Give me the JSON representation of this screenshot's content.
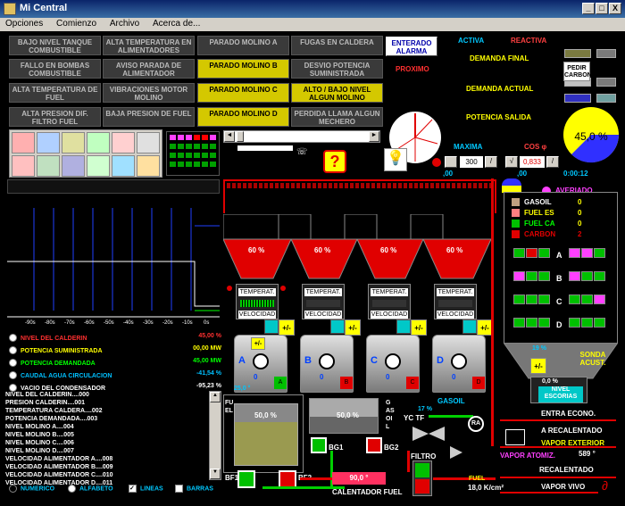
{
  "window": {
    "title": "Mi Central",
    "controls": [
      "_",
      "□",
      "X"
    ]
  },
  "menu": [
    "Opciones",
    "Comienzo",
    "Archivo",
    "Acerca de..."
  ],
  "alarms": {
    "col1": [
      "BAJO NIVEL TANQUE COMBUSTIBLE",
      "FALLO EN BOMBAS COMBUSTIBLE",
      "ALTA TEMPERATURA DE FUEL",
      "ALTA PRESION DIF. FILTRO FUEL"
    ],
    "col2": [
      "ALTA TEMPERATURA EN ALIMENTADORES",
      "AVISO PARADA DE ALIMENTADOR",
      "VIBRACIONES MOTOR MOLINO",
      "BAJA PRESION DE FUEL"
    ],
    "col3": [
      "PARADO MOLINO A",
      "PARADO MOLINO B",
      "PARADO MOLINO C",
      "PARADO MOLINO D"
    ],
    "col4": [
      "FUGAS EN CALDERA",
      "DESVIO POTENCIA SUMINISTRADA",
      "ALTO / BAJO NIVEL ALGUN MOLINO",
      "PERDIDA LLAMA ALGUN MECHERO"
    ]
  },
  "alarm_ack": {
    "label": "ENTERADO ALARMA",
    "next": "PROXIMO"
  },
  "power": {
    "activa": "ACTIVA",
    "reactiva": "REACTIVA",
    "demanda_final": "DEMANDA FINAL",
    "demanda_actual": "DEMANDA ACTUAL",
    "potencia_salida": "POTENCIA SALIDA",
    "pedir_carbon": "PEDIR CARBON",
    "maxima": "MAXIMA",
    "cos": "COS φ",
    "maxima_value": "300",
    "cos_value": "0,833",
    "zero_left": ",00",
    "zero_right": ",00",
    "time": "0:00:12",
    "pie_value": "45,0 %",
    "colors": {
      "activa": "#00c8ff",
      "reactiva": "#ff4040"
    }
  },
  "hoppers": [
    "60 %",
    "60 %",
    "60 %",
    "60 %"
  ],
  "mills": [
    {
      "id": "A",
      "value": "0",
      "btn": "A"
    },
    {
      "id": "B",
      "value": "0",
      "btn": "B"
    },
    {
      "id": "C",
      "value": "0",
      "btn": "C"
    },
    {
      "id": "D",
      "value": "0",
      "btn": "D"
    }
  ],
  "mill_labels": {
    "temp": "TEMPERAT.",
    "vel": "VELOCIDAD",
    "pm": "+/-"
  },
  "mill_a_temp": "25,0 °",
  "chart_axis": [
    "-90s",
    "-80s",
    "-70s",
    "-60s",
    "-50s",
    "-40s",
    "-30s",
    "-20s",
    "-10s",
    "0s"
  ],
  "params": [
    {
      "label": "NIVEL DEL CALDERIN",
      "value": "45,00 %",
      "color": "#ff3030"
    },
    {
      "label": "POTENCIA SUMINISTRADA",
      "value": "00,00 MW",
      "color": "#ffff00"
    },
    {
      "label": "POTENCIA DEMANDADA",
      "value": "45,00 MW",
      "color": "#00ff00"
    },
    {
      "label": "CAUDAL AGUA CIRCULACION",
      "value": "-41,54 %",
      "color": "#00c0ff"
    },
    {
      "label": "VACIO DEL CONDENSADOR",
      "value": "-95,23 %",
      "color": "#ffffff"
    }
  ],
  "codes": [
    "NIVEL DEL CALDERIN....000",
    "PRESION CALDERIN....001",
    "TEMPERATURA CALDERA....002",
    "POTENCIA DEMANDADA....003",
    "NIVEL MOLINO A....004",
    "NIVEL MOLINO B....005",
    "NIVEL MOLINO C....006",
    "NIVEL MOLINO D....007",
    "VELOCIDAD ALIMENTADOR A....008",
    "VELOCIDAD ALIMENTADOR B....009",
    "VELOCIDAD ALIMENTADOR C....010",
    "VELOCIDAD ALIMENTADOR D....011"
  ],
  "footer": {
    "numerico": "NUMERICO",
    "alfabeto": "ALFABETO",
    "lineas": "LINEAS",
    "barras": "BARRAS"
  },
  "fuel": {
    "fuel_label": "FUEL",
    "gasoil_label": "GASOIL",
    "tank_fuel": "50,0 %",
    "tank_gasoil": "50,0 %",
    "bf1": "BF1",
    "bf2": "BF2",
    "bg1": "BG1",
    "bg2": "BG2",
    "gasoil_tag": "GASOIL",
    "yc_tf": "YC TF",
    "pct17": "17 %",
    "ra": "RA",
    "filtro": "FILTRO",
    "calentador_val": "90,0 °",
    "calentador": "CALENTADOR FUEL",
    "fuel_out": "FUEL",
    "fuel_out_val": "18,0 K/cm²"
  },
  "right": {
    "averiado": "AVERIADO",
    "gasoil": "GASOIL",
    "fuel_es": "FUEL ES",
    "fuel_ca": "FUEL CA",
    "carbon": "CARBON",
    "v_gasoil": "0",
    "v_fuel_es": "0",
    "v_fuel_ca": "0",
    "v_carbon": "2",
    "rows": [
      "A",
      "B",
      "C",
      "D"
    ],
    "pct19": "19 %",
    "sonda": "SONDA ACUST.",
    "nivel_pct": "0,0 %",
    "nivel": "NIVEL ESCORIAS",
    "entra_econo": "ENTRA ECONO.",
    "a_recalentado": "A RECALENTADO",
    "vapor_exterior": "VAPOR EXTERIOR",
    "vapor_atomiz": "VAPOR ATOMIZ.",
    "vapor_atomiz_val": "589 °",
    "recalentado": "RECALENTADO",
    "vapor_vivo": "VAPOR VIVO"
  }
}
